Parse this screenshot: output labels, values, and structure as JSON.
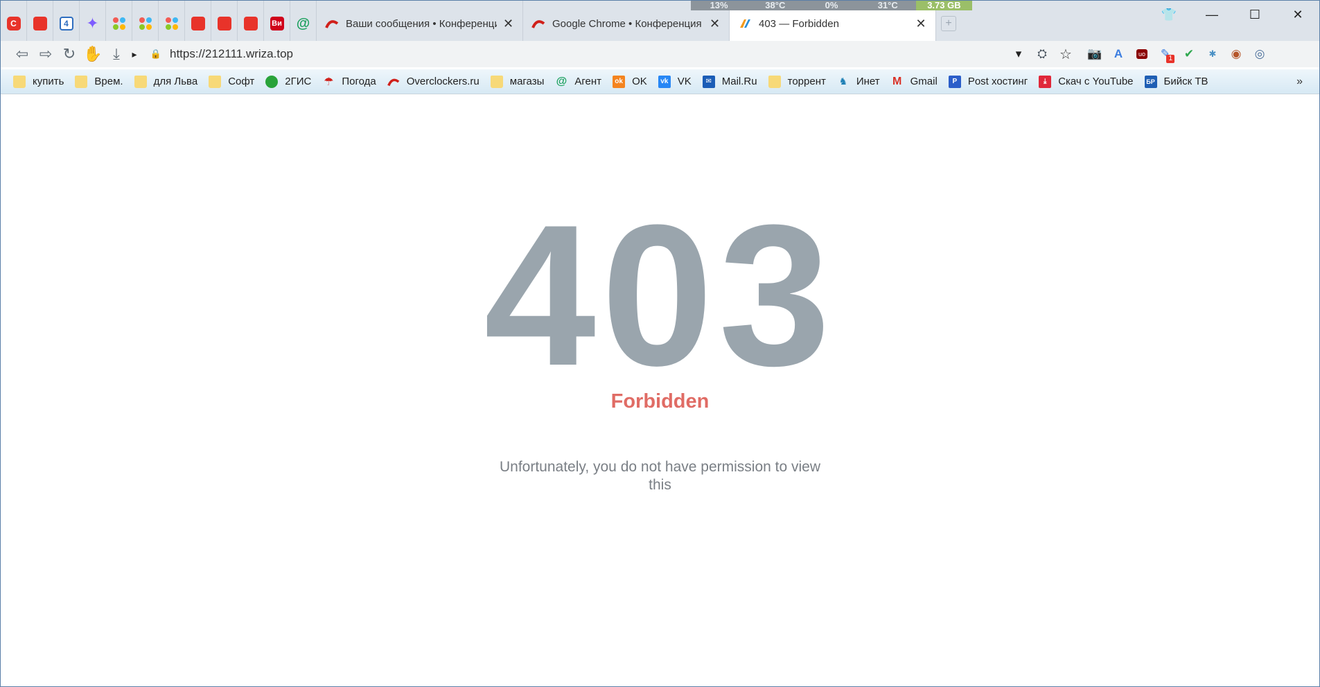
{
  "sysmon": {
    "cpu": "13%",
    "cpu_temp": "38°C",
    "gpu": "0%",
    "gpu_temp": "31°C",
    "ram": "3.73 GB"
  },
  "pinned_tabs": [
    {
      "icon": "aliexpress-c-icon",
      "glyph": "C"
    },
    {
      "icon": "aliexpress-icon",
      "glyph": ""
    },
    {
      "icon": "doc-4-icon",
      "glyph": "4"
    },
    {
      "icon": "sparkle-icon",
      "glyph": "✦"
    },
    {
      "icon": "dots-app-icon",
      "glyph": ""
    },
    {
      "icon": "dots-app-icon",
      "glyph": ""
    },
    {
      "icon": "dots-app-icon",
      "glyph": ""
    },
    {
      "icon": "aliexpress-icon",
      "glyph": ""
    },
    {
      "icon": "aliexpress-icon",
      "glyph": ""
    },
    {
      "icon": "aliexpress-icon",
      "glyph": ""
    },
    {
      "icon": "bn-icon",
      "glyph": "Ви"
    },
    {
      "icon": "agent-at-icon",
      "glyph": "@"
    }
  ],
  "tabs": [
    {
      "title": "Ваши сообщения • Конференция",
      "close": "✕",
      "active": false
    },
    {
      "title": "Google Chrome • Конференция C",
      "close": "✕",
      "active": false
    },
    {
      "title": "403 — Forbidden",
      "close": "✕",
      "active": true
    }
  ],
  "window_controls": {
    "shirt": "👕",
    "minimize": "—",
    "maximize": "☐",
    "close": "✕"
  },
  "toolbar": {
    "back": "⇦",
    "forward": "⇨",
    "reload": "↻",
    "stop": "✋",
    "download": "⤓",
    "more": "▸",
    "url": "https://212111.wriza.top",
    "lock": "🔒",
    "dropdown": "▾",
    "translate": "⛭",
    "star": "☆",
    "camera": "📷",
    "ext_translate": "A",
    "ublock": "uo",
    "ext_badge": "1",
    "shield": "✔",
    "puzzle": "✱",
    "avatar": "◉",
    "globe": "◎"
  },
  "bookmarks": [
    {
      "label": "купить",
      "icon": "folder-icon"
    },
    {
      "label": "Врем.",
      "icon": "folder-icon"
    },
    {
      "label": "для Льва",
      "icon": "folder-icon"
    },
    {
      "label": "Софт",
      "icon": "folder-icon"
    },
    {
      "label": "2ГИС",
      "icon": "2gis-icon"
    },
    {
      "label": "Погода",
      "icon": "umbrella-icon"
    },
    {
      "label": "Overclockers.ru",
      "icon": "overclockers-icon"
    },
    {
      "label": "магазы",
      "icon": "folder-icon"
    },
    {
      "label": "Агент",
      "icon": "agent-at-icon"
    },
    {
      "label": "OK",
      "icon": "ok-icon"
    },
    {
      "label": "VK",
      "icon": "vk-icon"
    },
    {
      "label": "Mail.Ru",
      "icon": "mailru-icon"
    },
    {
      "label": "торрент",
      "icon": "folder-icon"
    },
    {
      "label": "Инет",
      "icon": "bear-icon"
    },
    {
      "label": "Gmail",
      "icon": "gmail-icon"
    },
    {
      "label": "Post хостинг",
      "icon": "post-icon"
    },
    {
      "label": "Скач с YouTube",
      "icon": "download-icon"
    },
    {
      "label": "Бийск ТВ",
      "icon": "bp-icon"
    }
  ],
  "bookmarks_more": "»",
  "page": {
    "code": "403",
    "title": "Forbidden",
    "message": "Unfortunately, you do not have permission to view this"
  }
}
